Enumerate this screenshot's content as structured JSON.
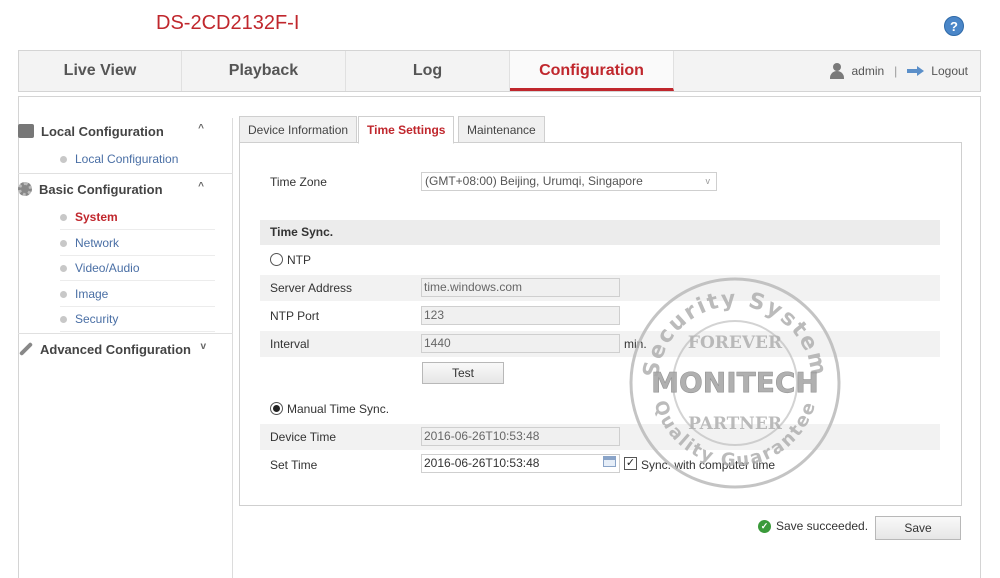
{
  "header": {
    "model": "DS-2CD2132F-I",
    "help_icon": "question-icon"
  },
  "nav": {
    "tabs": [
      {
        "label": "Live View"
      },
      {
        "label": "Playback"
      },
      {
        "label": "Log"
      },
      {
        "label": "Configuration"
      }
    ],
    "active_tab": "Configuration",
    "user": "admin",
    "separator": "|",
    "logout": "Logout"
  },
  "sidebar": {
    "local": {
      "title": "Local Configuration",
      "items": [
        {
          "label": "Local Configuration"
        }
      ]
    },
    "basic": {
      "title": "Basic Configuration",
      "items": [
        {
          "label": "System"
        },
        {
          "label": "Network"
        },
        {
          "label": "Video/Audio"
        },
        {
          "label": "Image"
        },
        {
          "label": "Security"
        }
      ],
      "active_item": "System"
    },
    "advanced": {
      "title": "Advanced Configuration"
    }
  },
  "tabs": [
    {
      "label": "Device Information"
    },
    {
      "label": "Time Settings"
    },
    {
      "label": "Maintenance"
    }
  ],
  "active_content_tab": "Time Settings",
  "form": {
    "time_zone_label": "Time Zone",
    "time_zone_value": "(GMT+08:00) Beijing, Urumqi, Singapore",
    "time_sync_heading": "Time Sync.",
    "ntp_label": "NTP",
    "ntp_selected": false,
    "server_address_label": "Server Address",
    "server_address_value": "time.windows.com",
    "ntp_port_label": "NTP Port",
    "ntp_port_value": "123",
    "interval_label": "Interval",
    "interval_value": "1440",
    "interval_unit": "min.",
    "test_button": "Test",
    "manual_label": "Manual Time Sync.",
    "manual_selected": true,
    "device_time_label": "Device Time",
    "device_time_value": "2016-06-26T10:53:48",
    "set_time_label": "Set Time",
    "set_time_value": "2016-06-26T10:53:48",
    "sync_computer_label": "Sync. with computer time",
    "sync_computer_checked": true
  },
  "footer": {
    "status": "Save succeeded.",
    "save_button": "Save"
  },
  "watermark": {
    "top_text": "Security System",
    "forever": "FOREVER",
    "brand": "MONITECH",
    "partner": "PARTNER",
    "bottom_text": "Quality Guarantee"
  },
  "colors": {
    "accent": "#c0272d",
    "link": "#4a6fa5",
    "success": "#3a9a3a"
  }
}
